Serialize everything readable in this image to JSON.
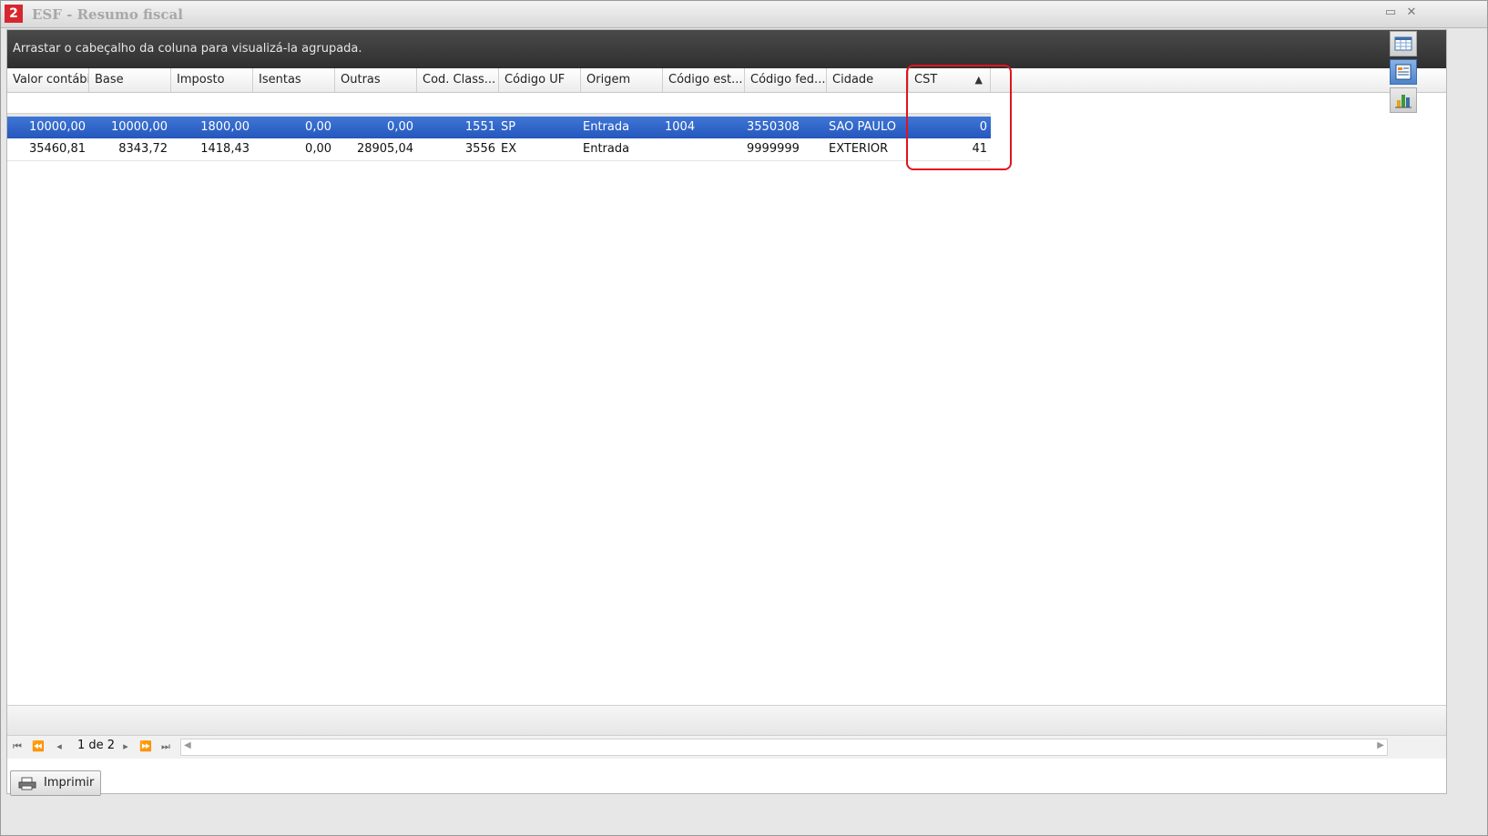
{
  "window": {
    "title": "ESF - Resumo fiscal",
    "logo_glyph": "2",
    "minimize_glyph": "▭",
    "close_glyph": "✕"
  },
  "group_panel": {
    "hint": "Arrastar o cabeçalho da coluna para visualizá-la agrupada."
  },
  "columns": [
    "Valor contábil",
    "Base",
    "Imposto",
    "Isentas",
    "Outras",
    "Cod. Class...",
    "Código UF",
    "Origem",
    "Código est...",
    "Código fed...",
    "Cidade",
    "CST"
  ],
  "sort": {
    "column": "CST",
    "direction": "ascending",
    "glyph": "▲"
  },
  "rows": [
    {
      "selected": true,
      "cells": [
        "10000,00",
        "10000,00",
        "1800,00",
        "0,00",
        "0,00",
        "1551",
        "SP",
        "Entrada",
        "1004",
        "3550308",
        "SAO PAULO",
        "0"
      ]
    },
    {
      "selected": false,
      "cells": [
        "35460,81",
        "8343,72",
        "1418,43",
        "0,00",
        "28905,04",
        "3556",
        "EX",
        "Entrada",
        "",
        "9999999",
        "EXTERIOR",
        "41"
      ]
    }
  ],
  "navigator": {
    "page_label": "1 de 2",
    "first_glyph": "⏮",
    "prev_page_glyph": "⏪",
    "prev_glyph": "◂",
    "next_glyph": "▸",
    "next_page_glyph": "⏩",
    "last_glyph": "⏭",
    "scroll_left_glyph": "◀",
    "scroll_right_glyph": "▶"
  },
  "side_toolbar": {
    "icons": [
      "grid-view-icon",
      "report-view-icon",
      "chart-view-icon"
    ],
    "active": "report-view-icon"
  },
  "footer": {
    "print_label": "Imprimir",
    "print_icon": "print-icon"
  },
  "colors": {
    "selection": "#2d62c8",
    "highlight_box": "#e0141e",
    "group_panel_bg": "#3a3a3a"
  }
}
